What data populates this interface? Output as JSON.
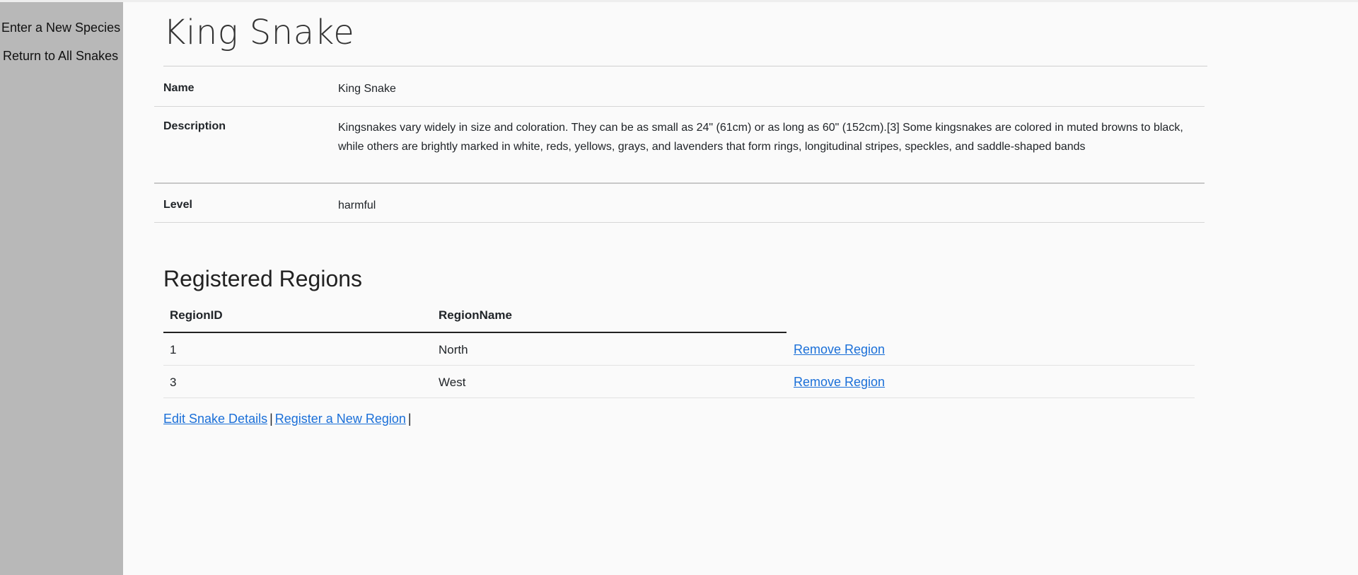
{
  "sidebar": {
    "items": [
      {
        "label": "Enter a New Species"
      },
      {
        "label": "Return to All Snakes"
      }
    ]
  },
  "page": {
    "title": "King Snake"
  },
  "details": {
    "name_label": "Name",
    "name_value": "King Snake",
    "description_label": "Description",
    "description_value": "Kingsnakes vary widely in size and coloration. They can be as small as 24\" (61cm) or as long as 60\" (152cm).[3] Some kingsnakes are colored in muted browns to black, while others are brightly marked in white, reds, yellows, grays, and lavenders that form rings, longitudinal stripes, speckles, and saddle-shaped bands",
    "level_label": "Level",
    "level_value": "harmful"
  },
  "regions": {
    "title": "Registered Regions",
    "columns": [
      "RegionID",
      "RegionName"
    ],
    "rows": [
      {
        "id": "1",
        "name": "North",
        "action": "Remove Region"
      },
      {
        "id": "3",
        "name": "West",
        "action": "Remove Region"
      }
    ]
  },
  "actions": {
    "edit_label": "Edit Snake Details",
    "separator": "|",
    "register_label": "Register a New Region"
  },
  "colors": {
    "sidebar_bg": "#b8b8b8",
    "page_bg": "#fafafa",
    "link": "#1a6fd8"
  }
}
